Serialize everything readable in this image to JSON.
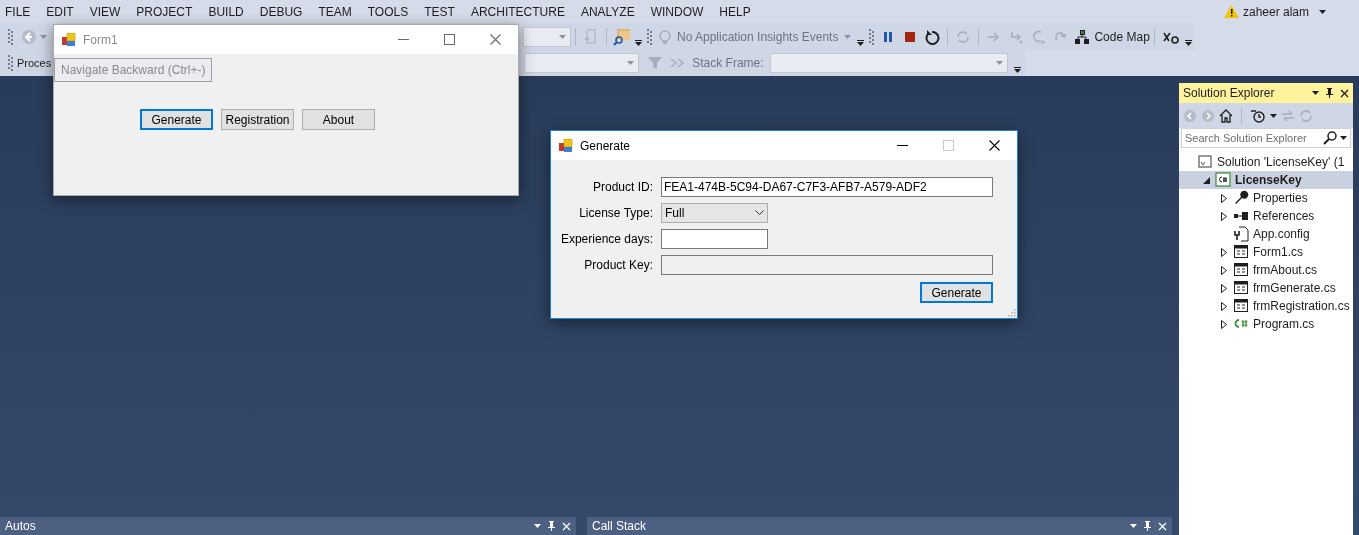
{
  "menu": [
    "FILE",
    "EDIT",
    "VIEW",
    "PROJECT",
    "BUILD",
    "DEBUG",
    "TEAM",
    "TOOLS",
    "TEST",
    "ARCHITECTURE",
    "ANALYZE",
    "WINDOW",
    "HELP"
  ],
  "account": {
    "name": "zaheer alam"
  },
  "toolbar": {
    "insights_dropdown": "No Application Insights Events",
    "code_map": "Code Map"
  },
  "debug_location_bar": {
    "process_label": "Proces",
    "stack_frame_label": "Stack Frame:"
  },
  "tooltip": "Navigate Backward (Ctrl+-)",
  "solution_explorer": {
    "title": "Solution Explorer",
    "search_placeholder": "Search Solution Explorer",
    "tree": [
      {
        "label": "Solution 'LicenseKey' (1",
        "kind": "solution",
        "selected": false,
        "expandable": false,
        "children": [
          {
            "label": "LicenseKey",
            "kind": "csproject",
            "selected": true,
            "expandable": true,
            "expanded": true,
            "children": [
              {
                "label": "Properties",
                "kind": "wrench",
                "selected": false,
                "expandable": true,
                "expanded": false
              },
              {
                "label": "References",
                "kind": "references",
                "selected": false,
                "expandable": true,
                "expanded": false
              },
              {
                "label": "App.config",
                "kind": "config",
                "selected": false,
                "expandable": false
              },
              {
                "label": "Form1.cs",
                "kind": "form",
                "selected": false,
                "expandable": true,
                "expanded": false
              },
              {
                "label": "frmAbout.cs",
                "kind": "form",
                "selected": false,
                "expandable": true,
                "expanded": false
              },
              {
                "label": "frmGenerate.cs",
                "kind": "form",
                "selected": false,
                "expandable": true,
                "expanded": false
              },
              {
                "label": "frmRegistration.cs",
                "kind": "form",
                "selected": false,
                "expandable": true,
                "expanded": false
              },
              {
                "label": "Program.cs",
                "kind": "csfile",
                "selected": false,
                "expandable": true,
                "expanded": false
              }
            ]
          }
        ]
      }
    ]
  },
  "bottom_panels": [
    {
      "title": "Autos"
    },
    {
      "title": "Call Stack"
    }
  ],
  "windows": [
    {
      "title": "Form1",
      "active": false,
      "maximize_enabled": true,
      "buttons": [
        {
          "label": "Generate",
          "focused": true
        },
        {
          "label": "Registration",
          "focused": false
        },
        {
          "label": "About",
          "focused": false
        }
      ]
    },
    {
      "title": "Generate",
      "active": true,
      "maximize_enabled": false,
      "fields": [
        {
          "kind": "text",
          "label": "Product ID:",
          "value": "FEA1-474B-5C94-DA67-C7F3-AFB7-A579-ADF2"
        },
        {
          "kind": "dropdown",
          "label": "License Type:",
          "value": "Full"
        },
        {
          "kind": "short_text",
          "label": "Experience days:"
        },
        {
          "kind": "readonly",
          "label": "Product Key:"
        }
      ],
      "buttons": [
        {
          "label": "Generate",
          "focused": true
        }
      ]
    }
  ]
}
